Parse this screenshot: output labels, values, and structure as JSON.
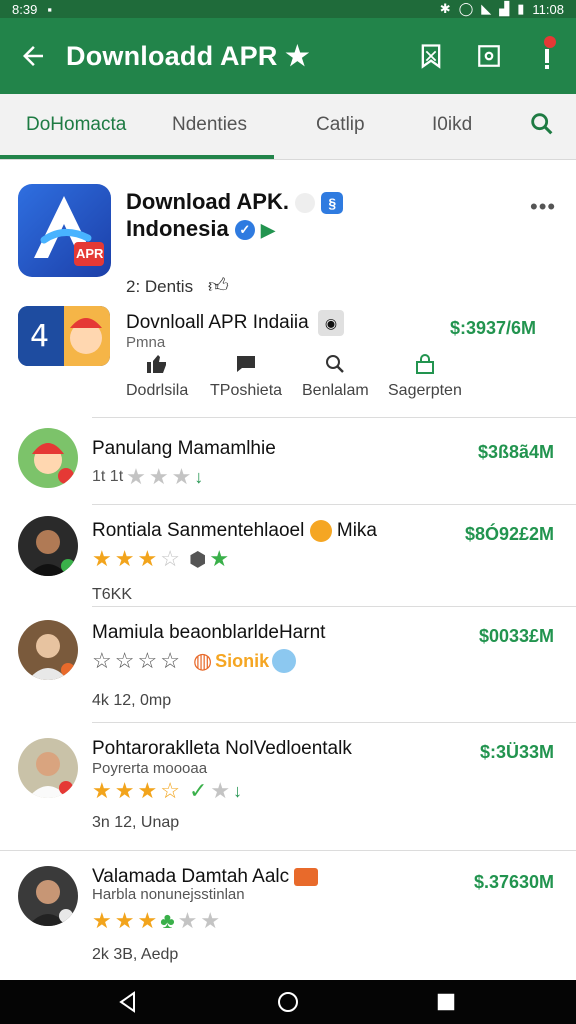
{
  "status_bar": {
    "time": "8:39",
    "battery_time": "11:08"
  },
  "app_bar": {
    "title": "Downloadd APR ★"
  },
  "tabs": [
    {
      "label": "DoHomacta",
      "active": true
    },
    {
      "label": "Ndenties",
      "active": false
    },
    {
      "label": "Catlip",
      "active": false
    },
    {
      "label": "I0ikd",
      "active": false
    }
  ],
  "hero": {
    "title_line1": "Download APK.",
    "title_line2": "Indonesia",
    "subtitle": "2: Dentis",
    "icon_badge": "APR"
  },
  "feature": {
    "title": "Dovnloall APR Indaiia",
    "subtitle": "Pmna",
    "price": "$:3937/6M",
    "actions": [
      {
        "label": "Dodrlsila",
        "icon": "thumbs-up-icon"
      },
      {
        "label": "TPoshieta",
        "icon": "chat-icon"
      },
      {
        "label": "Benlalam",
        "icon": "search-icon"
      },
      {
        "label": "Sagerpten",
        "icon": "lock-icon"
      }
    ]
  },
  "rows": [
    {
      "title": "Panulang Mamamlhie",
      "rating_text": "1t 1t",
      "stars": 2,
      "price": "$3ß8ã4M",
      "subtitle": "",
      "meta": ""
    },
    {
      "title": "Rontiala Sanmentehlaoel",
      "title_extra": "Mika",
      "stars": 3,
      "price": "$8Ó92£2M",
      "subtitle": "",
      "meta": "T6KK"
    },
    {
      "title": "Mamiula beaonblarldeHarnt",
      "stars": 4,
      "extra_label": "Sionik",
      "price": "$0033£M",
      "subtitle": "",
      "meta": "4k 12, 0mp"
    },
    {
      "title": "Pohtaroraklleta NolVedloentalk",
      "subtitle": "Poyrerta moooaa",
      "stars": 4,
      "price": "$:3Ü33M",
      "meta": "3n 12, Unap"
    },
    {
      "title": "Valamada Damtah Aalc",
      "subtitle": "Harbla nonunejsstinlan",
      "stars": 3,
      "price": "$.37630M",
      "meta": "2k 3B, Aedp"
    }
  ],
  "colors": {
    "primary": "#22844a",
    "accent_price": "#22944f",
    "star": "#f2a41c"
  }
}
